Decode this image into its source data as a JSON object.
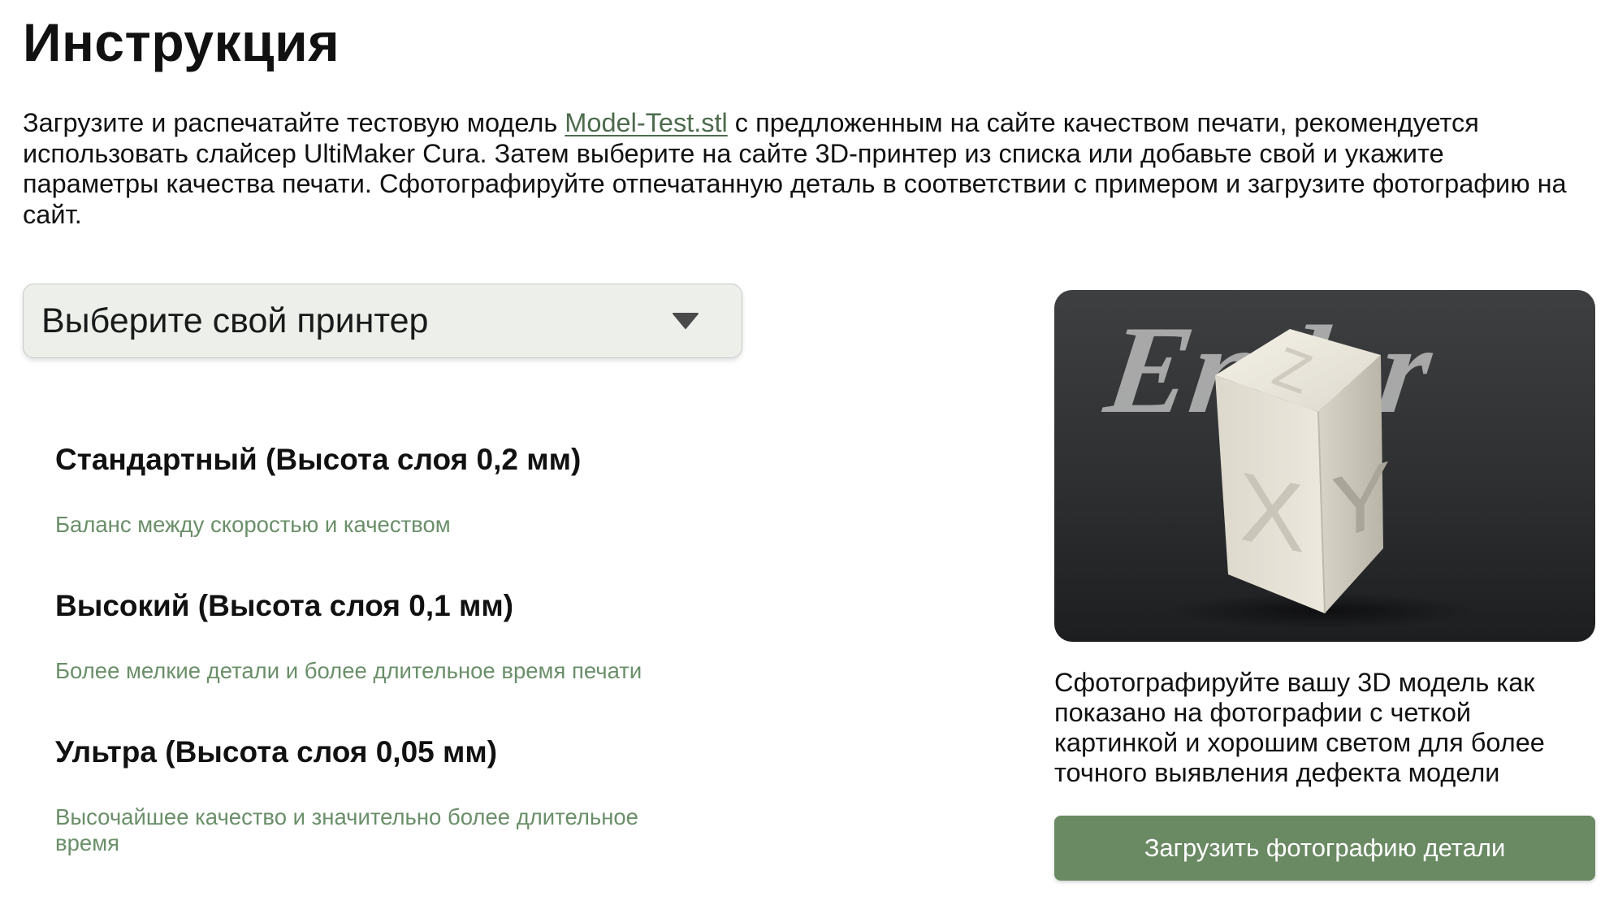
{
  "page": {
    "title": "Инструкция"
  },
  "intro": {
    "text_before": "Загрузите и распечатайте тестовую модель ",
    "link": "Model-Test.stl",
    "text_after": " с предложенным на сайте качеством печати, рекомендуется использовать слайсер UltiMaker Cura. Затем выберите на сайте 3D-принтер из списка или добавьте свой и укажите параметры качества печати. Сфотографируйте отпечатанную деталь в соответствии с примером и загрузите фотографию на сайт."
  },
  "printer_select": {
    "value": "Выберите свой принтер",
    "icon": "chevron-down-icon"
  },
  "quality_options": [
    {
      "title": "Стандартный (Высота слоя 0,2 мм)",
      "description": "Баланс между скоростью и качеством"
    },
    {
      "title": "Высокий (Высота слоя 0,1 мм)",
      "description": "Более мелкие детали и более длительное время печати"
    },
    {
      "title": "Ультра (Высота слоя 0,05 мм)",
      "description": "Высочайшее качество и значительно более длительное время"
    }
  ],
  "example": {
    "photo_text": "Ender",
    "cube_letters": [
      "X",
      "Y",
      "Z"
    ],
    "caption": "Сфотографируйте вашу 3D модель как показано на фотографии с четкой картинкой и хорошим светом для более точного выявления дефекта модели",
    "upload_button": "Загрузить фотографию детали"
  },
  "colors": {
    "accent_green": "#6a8a63",
    "description_green": "#6a8f69",
    "link_green": "#4d6b4d",
    "select_background": "#ecefea"
  }
}
